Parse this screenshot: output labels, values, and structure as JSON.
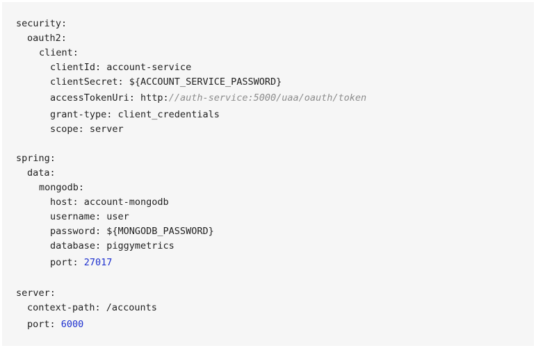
{
  "code": {
    "security_key": "security:",
    "oauth2_key": "oauth2:",
    "client_key": "client:",
    "client_id": "clientId: account-service",
    "client_secret": "clientSecret: ${ACCOUNT_SERVICE_PASSWORD}",
    "access_token_key": "accessTokenUri: http:",
    "access_token_comment": "//auth-service:5000/uaa/oauth/token",
    "grant_type": "grant-type: client_credentials",
    "scope": "scope: server",
    "spring_key": "spring:",
    "data_key": "data:",
    "mongodb_key": "mongodb:",
    "host": "host: account-mongodb",
    "username": "username: user",
    "password": "password: ${MONGODB_PASSWORD}",
    "database": "database: piggymetrics",
    "mongo_port_key": "port: ",
    "mongo_port_value": "27017",
    "server_key": "server:",
    "context_path": "context-path: /accounts",
    "server_port_key": "port: ",
    "server_port_value": "6000"
  },
  "colors": {
    "background": "#f6f6f6",
    "text": "#1f1f1f",
    "number": "#1c2fcf",
    "comment": "#8c8c8c"
  }
}
